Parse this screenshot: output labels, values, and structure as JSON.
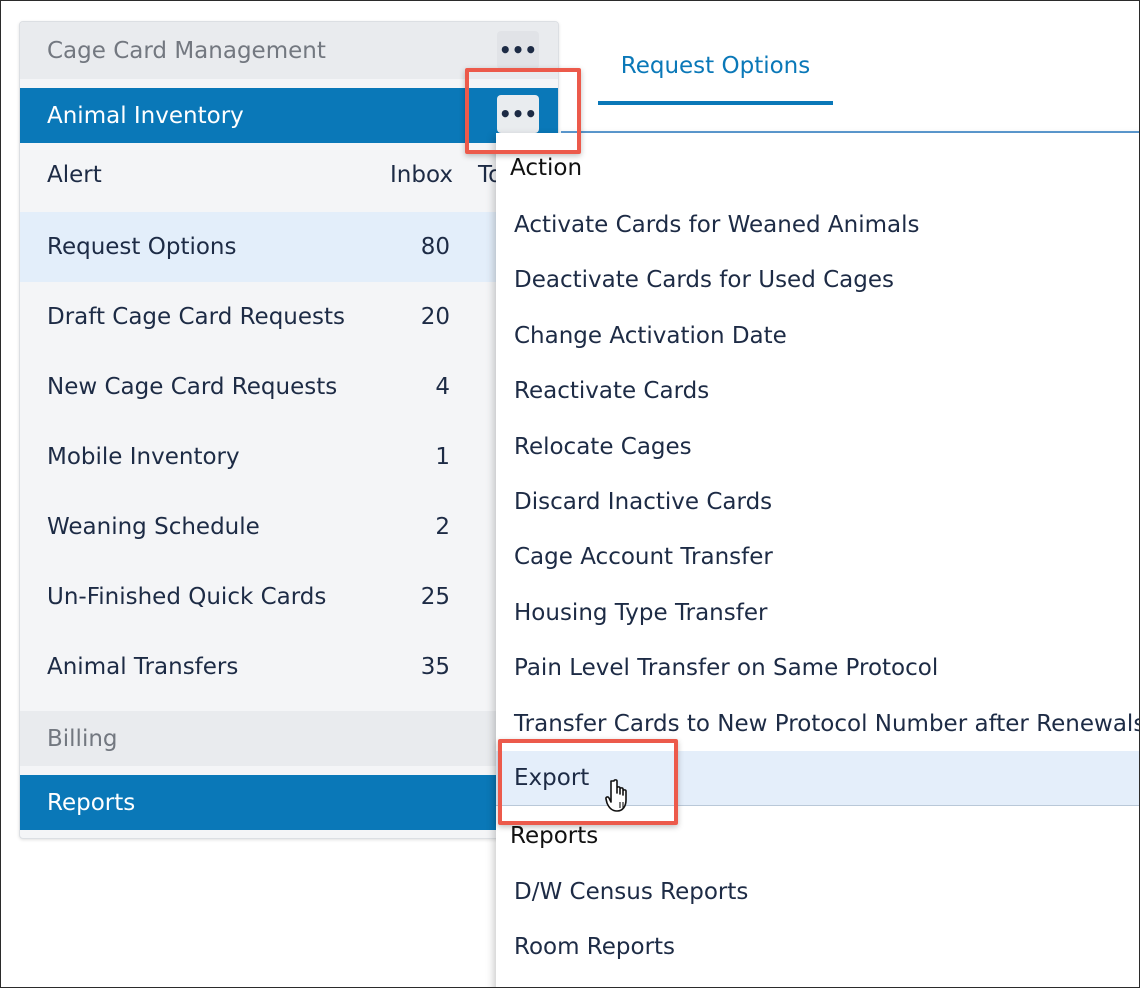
{
  "panel": {
    "cage_card_management": "Cage Card Management",
    "animal_inventory": "Animal Inventory",
    "more_glyph": "•••",
    "columns": {
      "alert": "Alert",
      "inbox": "Inbox",
      "to": "To"
    },
    "rows": [
      {
        "label": "Request Options",
        "count": "80"
      },
      {
        "label": "Draft Cage Card Requests",
        "count": "20"
      },
      {
        "label": "New Cage Card Requests",
        "count": "4"
      },
      {
        "label": "Mobile Inventory",
        "count": "1"
      },
      {
        "label": "Weaning Schedule",
        "count": "2"
      },
      {
        "label": "Un-Finished Quick Cards",
        "count": "25"
      },
      {
        "label": "Animal Transfers",
        "count": "35"
      }
    ],
    "billing": "Billing",
    "reports": "Reports"
  },
  "tab": {
    "label": "Request Options"
  },
  "dropdown": {
    "action_group": "Action",
    "action_items": [
      "Activate Cards for Weaned Animals",
      "Deactivate Cards for Used Cages",
      "Change Activation Date",
      "Reactivate Cards",
      "Relocate Cages",
      "Discard Inactive Cards",
      "Cage Account Transfer",
      "Housing Type Transfer",
      "Pain Level Transfer on Same Protocol",
      "Transfer Cards to New Protocol Number after Renewals",
      "Export"
    ],
    "reports_group": "Reports",
    "report_items": [
      "D/W Census Reports",
      "Room Reports"
    ]
  },
  "colors": {
    "accent_blue": "#0a78b8",
    "callout_red": "#ec5a4b",
    "hover_bg": "#e4eefa"
  }
}
